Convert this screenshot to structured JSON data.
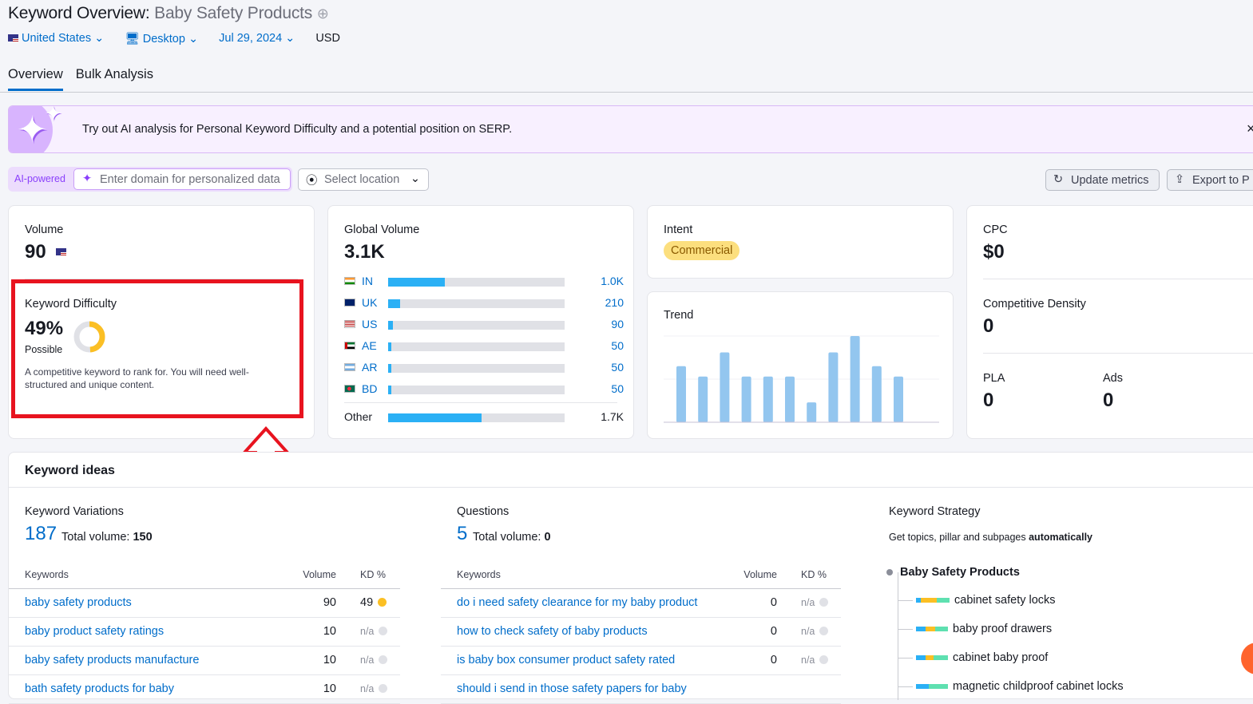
{
  "header": {
    "title": "Keyword Overview:",
    "keyword": "Baby Safety Products",
    "country": "United States",
    "device": "Desktop",
    "date": "Jul 29, 2024",
    "currency": "USD"
  },
  "tabs": [
    {
      "label": "Overview",
      "active": true
    },
    {
      "label": "Bulk Analysis",
      "active": false
    }
  ],
  "banner": {
    "pre": "Try out ",
    "bold": "AI analysis",
    "post": " for Personal Keyword Difficulty and a potential position on SERP.",
    "close": "×"
  },
  "ai": {
    "badge": "AI-powered",
    "placeholder": "Enter domain for personalized data",
    "location": "Select location"
  },
  "actions": {
    "update": "Update metrics",
    "export": "Export to P"
  },
  "volume": {
    "label": "Volume",
    "value": "90"
  },
  "kd": {
    "label": "Keyword Difficulty",
    "value": "49%",
    "percent": 49,
    "rating": "Possible",
    "desc": "A competitive keyword to rank for. You will need well-structured and unique content.",
    "color": "#fbbf24"
  },
  "global": {
    "label": "Global Volume",
    "value": "3.1K",
    "rows": [
      {
        "code": "IN",
        "value": "1.0K",
        "share": 32
      },
      {
        "code": "UK",
        "value": "210",
        "share": 6.8
      },
      {
        "code": "US",
        "value": "90",
        "share": 2.9
      },
      {
        "code": "AE",
        "value": "50",
        "share": 1.6
      },
      {
        "code": "AR",
        "value": "50",
        "share": 1.6
      },
      {
        "code": "BD",
        "value": "50",
        "share": 1.6
      }
    ],
    "other": {
      "label": "Other",
      "value": "1.7K",
      "share": 53
    }
  },
  "intent": {
    "label": "Intent",
    "value": "Commercial"
  },
  "trend": {
    "label": "Trend",
    "values": [
      65,
      53,
      81,
      53,
      53,
      53,
      23,
      81,
      100,
      65,
      53,
      0
    ]
  },
  "cpc": {
    "label": "CPC",
    "value": "$0"
  },
  "density": {
    "label": "Competitive Density",
    "value": "0"
  },
  "pla": {
    "label": "PLA",
    "value": "0"
  },
  "ads": {
    "label": "Ads",
    "value": "0"
  },
  "ideas": {
    "title": "Keyword ideas",
    "variations": {
      "label": "Keyword Variations",
      "count": "187",
      "total_label": "Total volume:",
      "total": "150",
      "cols": [
        "Keywords",
        "Volume",
        "KD %"
      ],
      "rows": [
        {
          "kw": "baby safety products",
          "vol": "90",
          "kd": "49",
          "color": "#fbbf24"
        },
        {
          "kw": "baby product safety ratings",
          "vol": "10",
          "kd": "n/a"
        },
        {
          "kw": "baby safety products manufacture",
          "vol": "10",
          "kd": "n/a"
        },
        {
          "kw": "bath safety products for baby",
          "vol": "10",
          "kd": "n/a"
        }
      ]
    },
    "questions": {
      "label": "Questions",
      "count": "5",
      "total_label": "Total volume:",
      "total": "0",
      "cols": [
        "Keywords",
        "Volume",
        "KD %"
      ],
      "rows": [
        {
          "kw": "do i need safety clearance for my baby product",
          "vol": "0",
          "kd": "n/a"
        },
        {
          "kw": "how to check safety of baby products",
          "vol": "0",
          "kd": "n/a"
        },
        {
          "kw": "is baby box consumer product safety rated",
          "vol": "0",
          "kd": "n/a"
        },
        {
          "kw": "should i send in those safety papers for baby",
          "vol": "",
          "kd": ""
        }
      ]
    },
    "strategy": {
      "label": "Keyword Strategy",
      "desc": "Get topics, pillar and subpages ",
      "desc_bold": "automatically",
      "root": "Baby Safety Products",
      "items": [
        "cabinet safety locks",
        "baby proof drawers",
        "cabinet baby proof",
        "magnetic childproof cabinet locks"
      ]
    }
  }
}
